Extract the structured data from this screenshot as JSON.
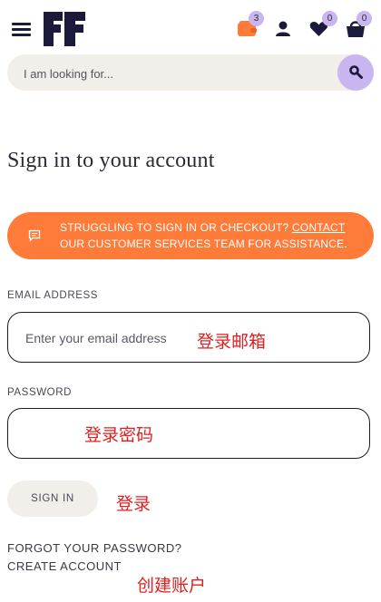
{
  "header": {
    "menu_icon": "hamburger-menu-icon",
    "logo_icon": "brand-logo",
    "wallet": {
      "icon": "wallet-icon",
      "count": "3"
    },
    "account_icon": "user-icon",
    "wishlist": {
      "icon": "heart-icon",
      "count": "0"
    },
    "basket": {
      "icon": "basket-icon",
      "count": "0"
    }
  },
  "search": {
    "placeholder": "I am looking for...",
    "button_icon": "search-icon"
  },
  "page_title": "Sign in to your account",
  "notice": {
    "icon": "message-icon",
    "line1_prefix": "STRUGGLING TO SIGN IN OR CHECKOUT?",
    "contact_link": "CONTACT",
    "line2": "OUR CUSTOMER SERVICES TEAM FOR ASSISTANCE."
  },
  "email": {
    "label": "EMAIL ADDRESS",
    "placeholder": "Enter your email address",
    "annotation": "登录邮箱"
  },
  "password": {
    "label": "PASSWORD",
    "annotation": "登录密码"
  },
  "sign_in": {
    "label": "SIGN IN",
    "annotation": "登录"
  },
  "links": {
    "forgot_password": "FORGOT YOUR PASSWORD?",
    "create_account": "CREATE ACCOUNT",
    "create_annotation": "创建账户"
  },
  "colors": {
    "brand_navy": "#1c1a3a",
    "accent_orange": "#ff7b3a",
    "badge_lilac": "#c9b5ef",
    "input_bg": "#f2eeea",
    "annotation_red": "#e02020"
  }
}
